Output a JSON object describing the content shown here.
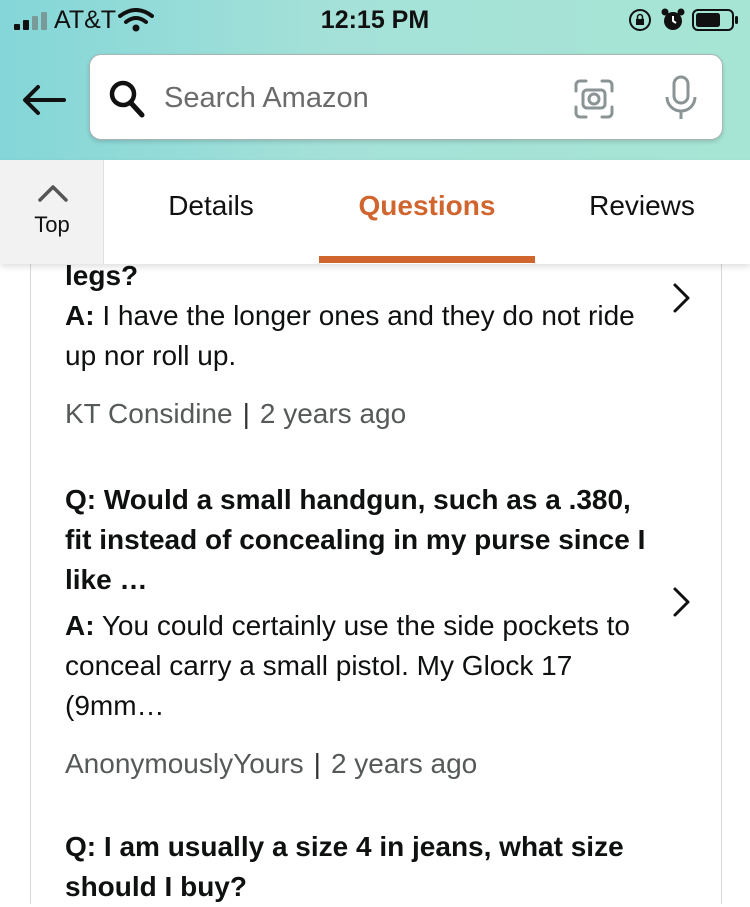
{
  "status_bar": {
    "carrier": "AT&T",
    "time": "12:15 PM"
  },
  "search": {
    "placeholder": "Search Amazon"
  },
  "tabs": {
    "top_label": "Top",
    "items": [
      {
        "label": "Details"
      },
      {
        "label": "Questions",
        "active": true
      },
      {
        "label": "Reviews"
      }
    ]
  },
  "qa": [
    {
      "question_partial": "legs?",
      "answer_label": "A:",
      "answer": " I have the longer ones and they do not ride up nor roll up.",
      "author": "KT Considine",
      "separator": "|",
      "date": "2 years ago"
    },
    {
      "question": "Q: Would a small handgun, such as a .380, fit instead of concealing in my purse since I like …",
      "answer_label": "A:",
      "answer": " You could certainly use the side pockets to conceal carry a small pistol. My Glock 17 (9mm…",
      "author": "AnonymouslyYours",
      "separator": "|",
      "date": "2 years ago"
    },
    {
      "question": "Q: I am usually a size 4 in jeans, what size should I buy?"
    }
  ],
  "colors": {
    "accent": "#d1652e",
    "header_start": "#84d6d8",
    "header_end": "#a6e5d4"
  },
  "icons": [
    "signal-icon",
    "wifi-icon",
    "lock-rotation-icon",
    "alarm-icon",
    "battery-icon",
    "back-arrow-icon",
    "search-icon",
    "camera-icon",
    "mic-icon",
    "chevron-up-icon",
    "chevron-right-icon"
  ]
}
